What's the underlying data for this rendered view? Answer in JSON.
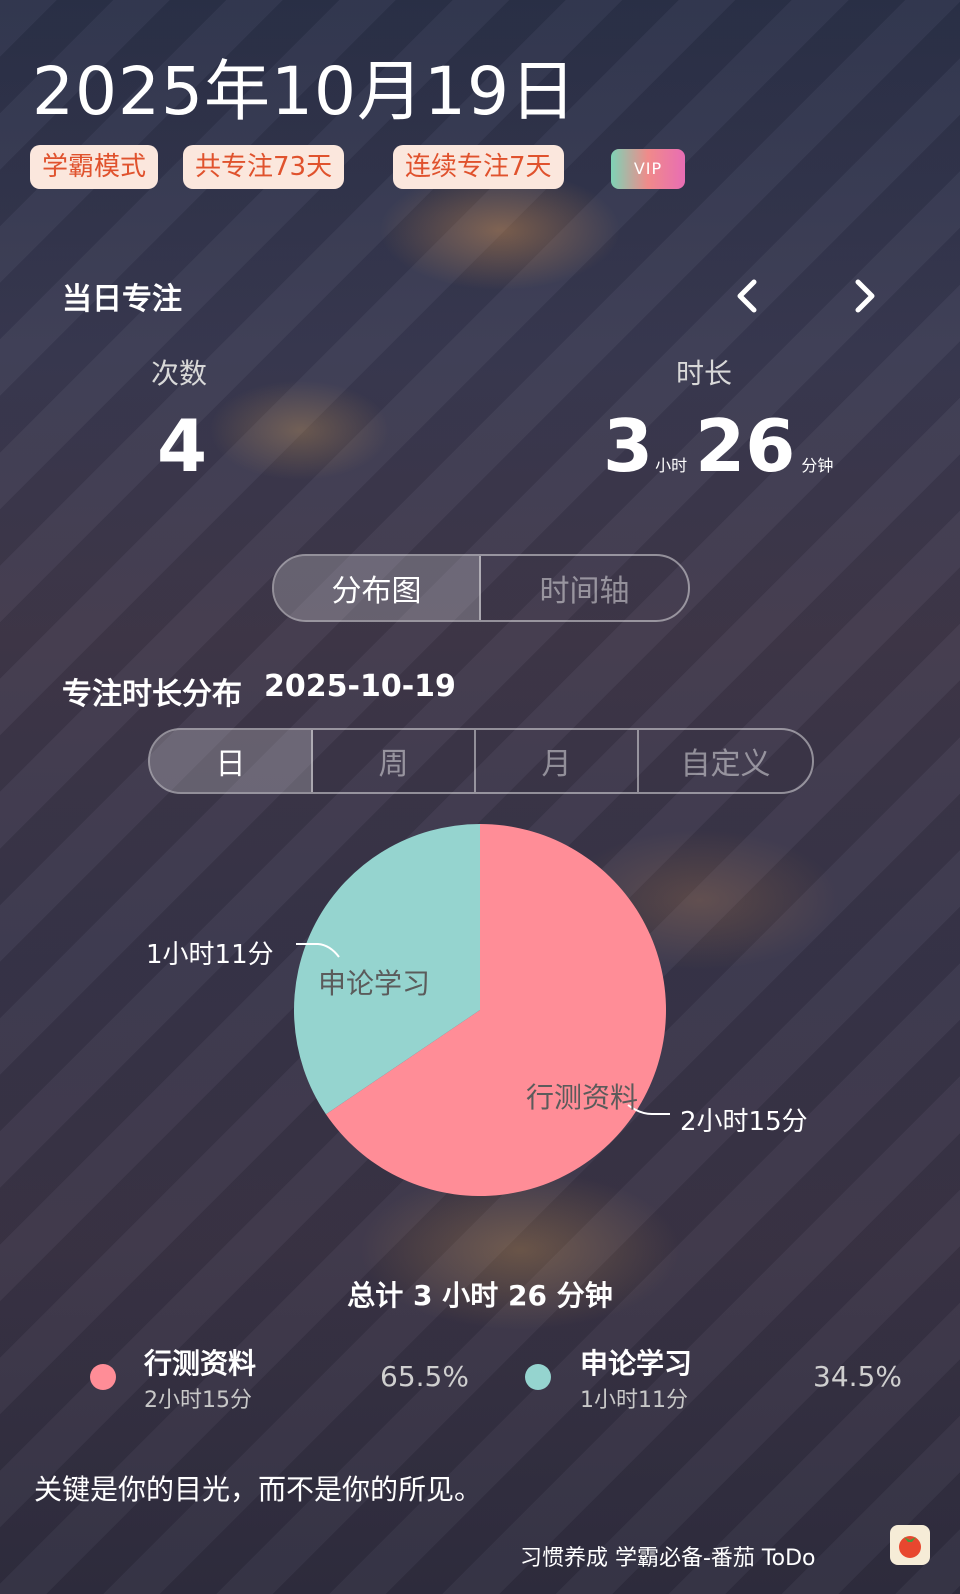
{
  "header": {
    "date": "2025年10月19日",
    "tags": [
      "学霸模式",
      "共专注73天",
      "连续专注7天"
    ],
    "vip": "VIP"
  },
  "day_focus": {
    "title": "当日专注",
    "count_label": "次数",
    "count": "4",
    "duration_label": "时长",
    "hours": "3",
    "hours_unit": "小时",
    "minutes": "26",
    "minutes_unit": "分钟"
  },
  "view_toggle": {
    "options": [
      "分布图",
      "时间轴"
    ],
    "active": 0
  },
  "distribution": {
    "title": "专注时长分布",
    "date": "2025-10-19",
    "ranges": [
      "日",
      "周",
      "月",
      "自定义"
    ],
    "active_range": 0,
    "total": "总计 3 小时 26 分钟"
  },
  "chart_data": {
    "type": "pie",
    "categories": [
      "行测资料",
      "申论学习"
    ],
    "values": [
      135,
      71
    ],
    "value_labels": [
      "2小时15分",
      "1小时11分"
    ],
    "percentages": [
      "65.5%",
      "34.5%"
    ],
    "colors": [
      "#ff8d97",
      "#95d4cf"
    ],
    "legend": "bottom"
  },
  "legend": [
    {
      "name": "行测资料",
      "duration": "2小时15分",
      "percent": "65.5%",
      "color": "#ff8d97"
    },
    {
      "name": "申论学习",
      "duration": "1小时11分",
      "percent": "34.5%",
      "color": "#95d4cf"
    }
  ],
  "quote": "关键是你的目光，而不是你的所见。",
  "footer": "习惯养成 学霸必备-番茄 ToDo",
  "icons": {
    "prev": "chevron-left-icon",
    "next": "chevron-right-icon",
    "app": "tomato-app-icon"
  }
}
